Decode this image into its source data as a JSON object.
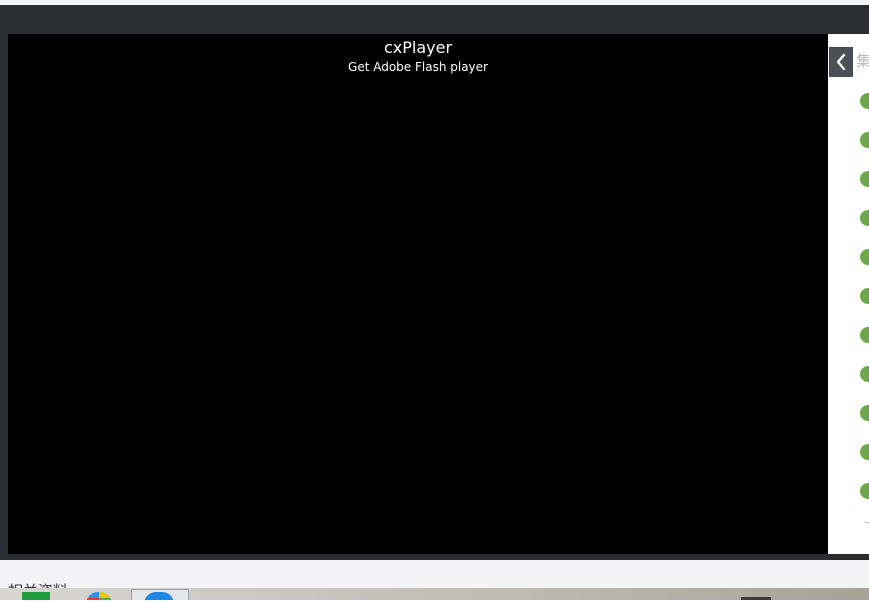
{
  "player": {
    "title": "cxPlayer",
    "subtitle": "Get Adobe Flash player"
  },
  "side_panel": {
    "label": "集",
    "collapse_icon": "chevron-left-icon",
    "items_color": "#6fa84a",
    "item_count": 11
  },
  "section": {
    "label": "相关资料"
  },
  "colors": {
    "frame": "#2b2d32",
    "player_bg": "#000000",
    "accent_green": "#6fa84a"
  }
}
